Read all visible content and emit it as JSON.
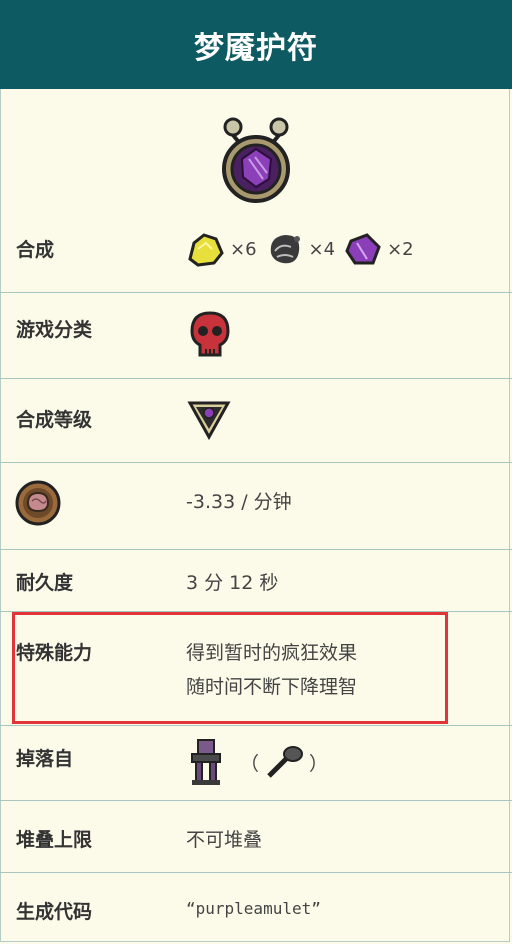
{
  "title": "梦魇护符",
  "item_icon": "nightmare-amulet-icon",
  "rows": {
    "recipe": {
      "label": "合成",
      "ingredients": [
        {
          "icon": "gold-nugget-icon",
          "count": "×6"
        },
        {
          "icon": "nightmare-fuel-icon",
          "count": "×4"
        },
        {
          "icon": "purple-gem-icon",
          "count": "×2"
        }
      ]
    },
    "category": {
      "label": "游戏分类",
      "icon": "red-skull-icon"
    },
    "tier": {
      "label": "合成等级",
      "icon": "shadow-manipulator-icon"
    },
    "sanity": {
      "icon": "sanity-brain-icon",
      "value": "-3.33 / 分钟"
    },
    "durability": {
      "label": "耐久度",
      "value": "3 分 12 秒"
    },
    "ability": {
      "label": "特殊能力",
      "line1": "得到暂时的疯狂效果",
      "line2": "随时间不断下降理智"
    },
    "drop": {
      "label": "掉落自",
      "open": "（",
      "close": "）",
      "icon1": "pedestal-icon",
      "icon2": "hammer-icon"
    },
    "stack": {
      "label": "堆叠上限",
      "value": "不可堆叠"
    },
    "code": {
      "label": "生成代码",
      "value": "“purpleamulet”"
    }
  },
  "colors": {
    "header": "#0d5a62",
    "background": "#fcfbea",
    "highlight": "#e0343a"
  }
}
